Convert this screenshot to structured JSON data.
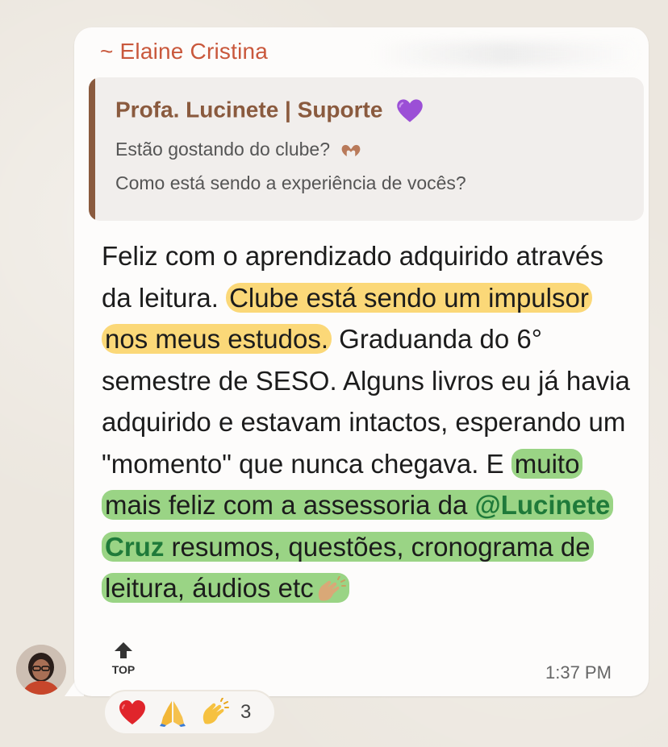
{
  "message": {
    "sender": "~ Elaine Cristina",
    "quoted": {
      "author": "Profa. Lucinete | Suporte",
      "line1": "Estão gostando do clube?",
      "line2": "Como está sendo a experiência de vocês?"
    },
    "body": {
      "p1": "Feliz com o aprendizado adquirido através da leitura. ",
      "highlight_yellow": "Clube está sendo um impulsor nos meus estudos.",
      "p2": " Graduanda do 6° semestre de SESO. Alguns livros eu já havia adquirido e estavam intactos, esperando um \"momento\" que nunca chegava. E ",
      "highlight_green_a": "muito mais feliz com a assessoria da ",
      "mention": "@Lucinete Cruz",
      "highlight_green_b": " resumos, questões, cronograma de leitura, áudios etc"
    },
    "time": "1:37 PM",
    "top_label": "TOP"
  },
  "reactions": {
    "emojis": [
      "heart-icon",
      "praying-hands-icon",
      "clapping-hands-icon"
    ],
    "count": "3"
  },
  "colors": {
    "sender": "#c9583c",
    "quote_author": "#8a5a3e",
    "highlight_yellow": "#fbd878",
    "highlight_green": "#9ad485",
    "mention": "#1f7a3a"
  }
}
